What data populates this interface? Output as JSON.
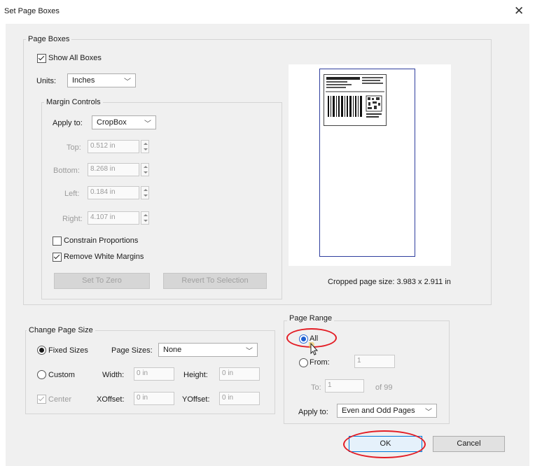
{
  "dialog": {
    "title": "Set Page Boxes",
    "close_icon": "close-icon"
  },
  "page_boxes": {
    "group_label": "Page Boxes",
    "show_all_boxes": {
      "label": "Show All Boxes",
      "checked": true
    },
    "units": {
      "label": "Units:",
      "value": "Inches"
    },
    "margin_controls": {
      "group_label": "Margin Controls",
      "apply_to": {
        "label": "Apply to:",
        "value": "CropBox"
      },
      "top": {
        "label": "Top:",
        "value": "0.512 in"
      },
      "bottom": {
        "label": "Bottom:",
        "value": "8.268 in"
      },
      "left": {
        "label": "Left:",
        "value": "0.184 in"
      },
      "right": {
        "label": "Right:",
        "value": "4.107 in"
      },
      "constrain_proportions": {
        "label": "Constrain Proportions",
        "checked": false
      },
      "remove_white_margins": {
        "label": "Remove White Margins",
        "checked": true
      },
      "set_to_zero": "Set To Zero",
      "revert_to_selection": "Revert To Selection"
    },
    "cropped_size": "Cropped page size: 3.983 x 2.911 in"
  },
  "change_page_size": {
    "group_label": "Change Page Size",
    "fixed_sizes": {
      "label": "Fixed Sizes",
      "selected": true
    },
    "page_sizes": {
      "label": "Page Sizes:",
      "value": "None"
    },
    "custom": {
      "label": "Custom",
      "selected": false
    },
    "width": {
      "label": "Width:",
      "value": "0 in"
    },
    "height": {
      "label": "Height:",
      "value": "0 in"
    },
    "center": {
      "label": "Center",
      "checked": true
    },
    "xoffset": {
      "label": "XOffset:",
      "value": "0 in"
    },
    "yoffset": {
      "label": "YOffset:",
      "value": "0 in"
    }
  },
  "page_range": {
    "group_label": "Page Range",
    "all": {
      "label": "All",
      "selected": true
    },
    "from": {
      "label": "From:",
      "value": "1"
    },
    "to": {
      "label": "To:",
      "value": "1"
    },
    "of": "of 99",
    "apply_to": {
      "label": "Apply to:",
      "value": "Even and Odd Pages"
    }
  },
  "buttons": {
    "ok": "OK",
    "cancel": "Cancel"
  },
  "colors": {
    "highlight_ring": "#e31d25",
    "page_border": "#2f3e9e",
    "dialog_bg": "#f0f0f0"
  }
}
